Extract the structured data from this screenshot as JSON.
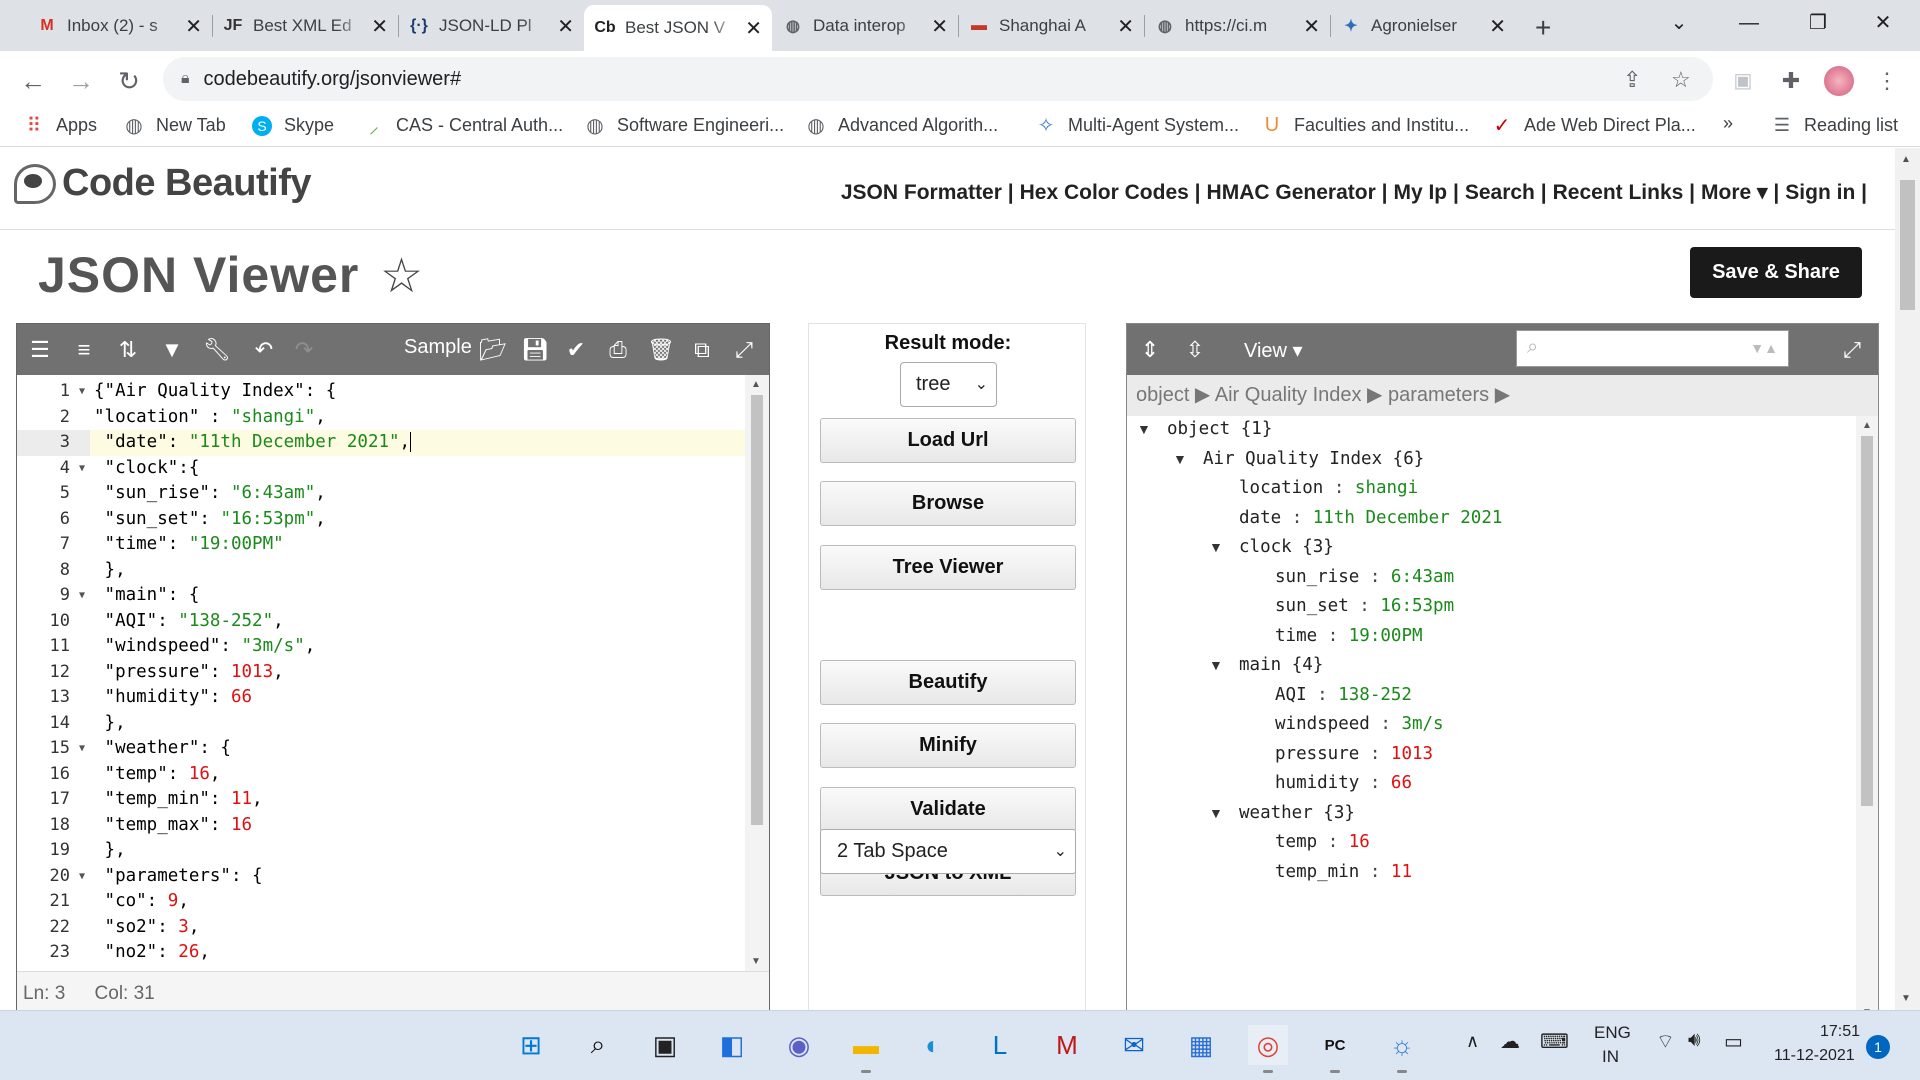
{
  "browser": {
    "tabs": [
      {
        "title": "Inbox (2) - s",
        "icon": "gmail-icon",
        "fav": "M",
        "color": "#d93025",
        "active": false
      },
      {
        "title": "Best XML Ed",
        "icon": "jf-icon",
        "fav": "JF",
        "color": "#333333",
        "active": false
      },
      {
        "title": "JSON-LD Pl",
        "icon": "jsonld-icon",
        "fav": "{·}",
        "color": "#1a3c6e",
        "active": false
      },
      {
        "title": "Best JSON V",
        "icon": "codebeautify-icon",
        "fav": "Cb",
        "color": "#222222",
        "active": true
      },
      {
        "title": "Data interop",
        "icon": "globe-icon",
        "fav": "◍",
        "color": "#5f6368",
        "active": false
      },
      {
        "title": "Shanghai A",
        "icon": "flag-icon",
        "fav": "▬",
        "color": "#c0392b",
        "active": false
      },
      {
        "title": "https://ci.m",
        "icon": "globe-icon",
        "fav": "◍",
        "color": "#5f6368",
        "active": false
      },
      {
        "title": "Agronielser",
        "icon": "agro-icon",
        "fav": "✦",
        "color": "#2a6ebb",
        "active": false
      }
    ],
    "new_tab": "+",
    "url": "codebeautify.org/jsonviewer#",
    "bookmarks": [
      {
        "label": "Apps",
        "icon": "apps-grid-icon",
        "color": "#e8453c"
      },
      {
        "label": "New Tab",
        "icon": "globe-icon",
        "color": "#5f6368"
      },
      {
        "label": "Skype",
        "icon": "skype-icon",
        "color": "#00aff0"
      },
      {
        "label": "CAS - Central Auth...",
        "icon": "cas-icon",
        "color": "#6aa84f"
      },
      {
        "label": "Software Engineeri...",
        "icon": "globe-icon",
        "color": "#5f6368"
      },
      {
        "label": "Advanced Algorith...",
        "icon": "globe-icon",
        "color": "#5f6368"
      },
      {
        "label": "Multi-Agent System...",
        "icon": "agent-icon",
        "color": "#3d85c6"
      },
      {
        "label": "Faculties and Institu...",
        "icon": "shield-icon",
        "color": "#e69138"
      },
      {
        "label": "Ade Web Direct Pla...",
        "icon": "check-icon",
        "color": "#cc0000"
      }
    ],
    "bookmarks_more": "»",
    "reading_list": "Reading list"
  },
  "site": {
    "logo": "Code Beautify",
    "nav": [
      "JSON Formatter |",
      "Hex Color Codes |",
      "HMAC Generator |",
      "My Ip |",
      "Search |",
      "Recent Links |",
      "More ▾ |",
      "Sign in |"
    ],
    "page_title": "JSON Viewer",
    "save_share": "Save & Share"
  },
  "editor": {
    "sample_label": "Sample",
    "status_ln": "Ln: 3",
    "status_col": "Col: 31",
    "lines": [
      {
        "n": "1",
        "fold": true,
        "code": [
          [
            "k",
            "{\"Air Quality Index\": {"
          ]
        ]
      },
      {
        "n": "2",
        "fold": false,
        "code": [
          [
            "k",
            "\"location\" : "
          ],
          [
            "s",
            "\"shangi\""
          ],
          [
            "k",
            ","
          ]
        ]
      },
      {
        "n": "3",
        "fold": false,
        "hl": true,
        "code": [
          [
            "k",
            " \"date\": "
          ],
          [
            "s",
            "\"11th December 2021\""
          ],
          [
            "k",
            ","
          ]
        ]
      },
      {
        "n": "4",
        "fold": true,
        "code": [
          [
            "k",
            " \"clock\":{"
          ]
        ]
      },
      {
        "n": "5",
        "fold": false,
        "code": [
          [
            "k",
            " \"sun_rise\": "
          ],
          [
            "s",
            "\"6:43am\""
          ],
          [
            "k",
            ","
          ]
        ]
      },
      {
        "n": "6",
        "fold": false,
        "code": [
          [
            "k",
            " \"sun_set\": "
          ],
          [
            "s",
            "\"16:53pm\""
          ],
          [
            "k",
            ","
          ]
        ]
      },
      {
        "n": "7",
        "fold": false,
        "code": [
          [
            "k",
            " \"time\": "
          ],
          [
            "s",
            "\"19:00PM\""
          ]
        ]
      },
      {
        "n": "8",
        "fold": false,
        "code": [
          [
            "k",
            " },"
          ]
        ]
      },
      {
        "n": "9",
        "fold": true,
        "code": [
          [
            "k",
            " \"main\": {"
          ]
        ]
      },
      {
        "n": "10",
        "fold": false,
        "code": [
          [
            "k",
            " \"AQI\": "
          ],
          [
            "s",
            "\"138-252\""
          ],
          [
            "k",
            ","
          ]
        ]
      },
      {
        "n": "11",
        "fold": false,
        "code": [
          [
            "k",
            " \"windspeed\": "
          ],
          [
            "s",
            "\"3m/s\""
          ],
          [
            "k",
            ","
          ]
        ]
      },
      {
        "n": "12",
        "fold": false,
        "code": [
          [
            "k",
            " \"pressure\": "
          ],
          [
            "n",
            "1013"
          ],
          [
            "k",
            ","
          ]
        ]
      },
      {
        "n": "13",
        "fold": false,
        "code": [
          [
            "k",
            " \"humidity\": "
          ],
          [
            "n",
            "66"
          ]
        ]
      },
      {
        "n": "14",
        "fold": false,
        "code": [
          [
            "k",
            " },"
          ]
        ]
      },
      {
        "n": "15",
        "fold": true,
        "code": [
          [
            "k",
            " \"weather\": {"
          ]
        ]
      },
      {
        "n": "16",
        "fold": false,
        "code": [
          [
            "k",
            " \"temp\": "
          ],
          [
            "n",
            "16"
          ],
          [
            "k",
            ","
          ]
        ]
      },
      {
        "n": "17",
        "fold": false,
        "code": [
          [
            "k",
            " \"temp_min\": "
          ],
          [
            "n",
            "11"
          ],
          [
            "k",
            ","
          ]
        ]
      },
      {
        "n": "18",
        "fold": false,
        "code": [
          [
            "k",
            " \"temp_max\": "
          ],
          [
            "n",
            "16"
          ]
        ]
      },
      {
        "n": "19",
        "fold": false,
        "code": [
          [
            "k",
            " },"
          ]
        ]
      },
      {
        "n": "20",
        "fold": true,
        "code": [
          [
            "k",
            " \"parameters\": {"
          ]
        ]
      },
      {
        "n": "21",
        "fold": false,
        "code": [
          [
            "k",
            " \"co\": "
          ],
          [
            "n",
            "9"
          ],
          [
            "k",
            ","
          ]
        ]
      },
      {
        "n": "22",
        "fold": false,
        "code": [
          [
            "k",
            " \"so2\": "
          ],
          [
            "n",
            "3"
          ],
          [
            "k",
            ","
          ]
        ]
      },
      {
        "n": "23",
        "fold": false,
        "code": [
          [
            "k",
            " \"no2\": "
          ],
          [
            "n",
            "26"
          ],
          [
            "k",
            ","
          ]
        ]
      }
    ]
  },
  "middle": {
    "result_mode_label": "Result mode:",
    "result_mode_value": "tree",
    "buttons": [
      "Load Url",
      "Browse",
      "Tree Viewer",
      "Beautify",
      "Minify",
      "Validate",
      "JSON to XML"
    ],
    "tab_space": "2 Tab Space"
  },
  "tree": {
    "view_label": "View ▾",
    "breadcrumb": "object ▶ Air Quality Index ▶ parameters ▶",
    "nodes": [
      {
        "d": 0,
        "tri": "▼",
        "key": "object",
        "meta": " {1}"
      },
      {
        "d": 1,
        "tri": "▼",
        "key": "Air Quality Index",
        "meta": " {6}"
      },
      {
        "d": 2,
        "tri": "",
        "key": "location",
        "val": "shangi",
        "t": "s"
      },
      {
        "d": 2,
        "tri": "",
        "key": "date",
        "val": "11th December 2021",
        "t": "s"
      },
      {
        "d": 2,
        "tri": "▼",
        "key": "clock",
        "meta": " {3}"
      },
      {
        "d": 3,
        "tri": "",
        "key": "sun_rise",
        "val": "6:43am",
        "t": "s"
      },
      {
        "d": 3,
        "tri": "",
        "key": "sun_set",
        "val": "16:53pm",
        "t": "s"
      },
      {
        "d": 3,
        "tri": "",
        "key": "time",
        "val": "19:00PM",
        "t": "s"
      },
      {
        "d": 2,
        "tri": "▼",
        "key": "main",
        "meta": " {4}"
      },
      {
        "d": 3,
        "tri": "",
        "key": "AQI",
        "val": "138-252",
        "t": "s"
      },
      {
        "d": 3,
        "tri": "",
        "key": "windspeed",
        "val": "3m/s",
        "t": "s"
      },
      {
        "d": 3,
        "tri": "",
        "key": "pressure",
        "val": "1013",
        "t": "n"
      },
      {
        "d": 3,
        "tri": "",
        "key": "humidity",
        "val": "66",
        "t": "n"
      },
      {
        "d": 2,
        "tri": "▼",
        "key": "weather",
        "meta": " {3}"
      },
      {
        "d": 3,
        "tri": "",
        "key": "temp",
        "val": "16",
        "t": "n"
      },
      {
        "d": 3,
        "tri": "",
        "key": "temp_min",
        "val": "11",
        "t": "n"
      }
    ]
  },
  "taskbar": {
    "icons": [
      "windows-start-icon",
      "search-icon",
      "task-view-icon",
      "widgets-icon",
      "teams-chat-icon",
      "file-explorer-icon",
      "edge-icon",
      "lync-icon",
      "mcafee-icon",
      "mail-icon",
      "store-icon",
      "chrome-icon",
      "pycharm-icon",
      "weather-app-icon"
    ],
    "lang_top": "ENG",
    "lang_bottom": "IN",
    "time": "17:51",
    "date": "11-12-2021",
    "notifications": "1"
  }
}
